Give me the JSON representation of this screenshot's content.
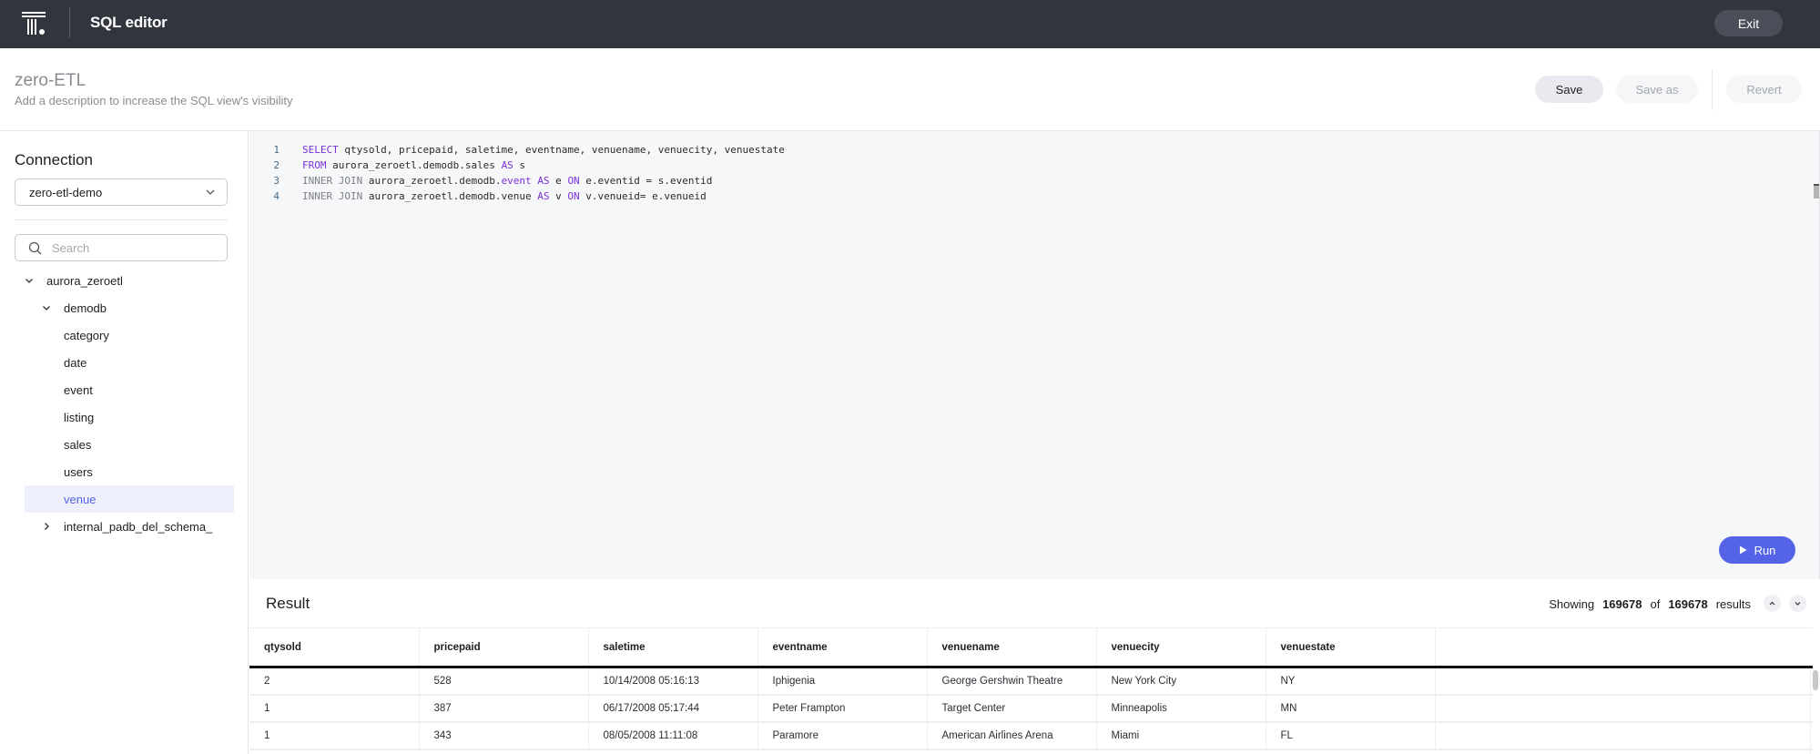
{
  "topbar": {
    "logo": "thoughtspot-logo",
    "title": "SQL editor",
    "exit_label": "Exit"
  },
  "header": {
    "title": "zero-ETL",
    "description": "Add a description to increase the SQL view's visibility",
    "save_label": "Save",
    "save_as_label": "Save as",
    "revert_label": "Revert"
  },
  "sidebar": {
    "connection_label": "Connection",
    "connection_value": "zero-etl-demo",
    "search_placeholder": "Search",
    "tree": [
      {
        "label": "aurora_zeroetl",
        "level": 0,
        "expanded": true
      },
      {
        "label": "demodb",
        "level": 1,
        "expanded": true
      },
      {
        "label": "category",
        "level": 2
      },
      {
        "label": "date",
        "level": 2
      },
      {
        "label": "event",
        "level": 2
      },
      {
        "label": "listing",
        "level": 2
      },
      {
        "label": "sales",
        "level": 2
      },
      {
        "label": "users",
        "level": 2
      },
      {
        "label": "venue",
        "level": 2,
        "selected": true
      },
      {
        "label": "internal_padb_del_schema_",
        "level": 1,
        "expanded": false
      }
    ]
  },
  "editor": {
    "lines": [
      {
        "num": "1",
        "tokens": [
          {
            "t": "SELECT",
            "c": "kw"
          },
          {
            "t": " qtysold, pricepaid, saletime, eventname, venuename, venuecity, venuestate",
            "c": ""
          }
        ]
      },
      {
        "num": "2",
        "tokens": [
          {
            "t": "FROM",
            "c": "kw"
          },
          {
            "t": " aurora_zeroetl.demodb.sales ",
            "c": ""
          },
          {
            "t": "AS",
            "c": "kw"
          },
          {
            "t": " s",
            "c": ""
          }
        ]
      },
      {
        "num": "3",
        "tokens": [
          {
            "t": "INNER JOIN",
            "c": "kw2"
          },
          {
            "t": " aurora_zeroetl.demodb.",
            "c": ""
          },
          {
            "t": "event",
            "c": "kw"
          },
          {
            "t": " ",
            "c": ""
          },
          {
            "t": "AS",
            "c": "kw"
          },
          {
            "t": " e ",
            "c": ""
          },
          {
            "t": "ON",
            "c": "kw"
          },
          {
            "t": " e.eventid = s.eventid",
            "c": ""
          }
        ]
      },
      {
        "num": "4",
        "tokens": [
          {
            "t": "INNER JOIN",
            "c": "kw2"
          },
          {
            "t": " aurora_zeroetl.demodb.venue ",
            "c": ""
          },
          {
            "t": "AS",
            "c": "kw"
          },
          {
            "t": " v ",
            "c": ""
          },
          {
            "t": "ON",
            "c": "kw"
          },
          {
            "t": " v.venueid= e.venueid",
            "c": ""
          }
        ]
      }
    ],
    "run_label": "Run"
  },
  "result": {
    "title": "Result",
    "showing_label": "Showing",
    "shown_count": "169678",
    "of_label": "of",
    "total_count": "169678",
    "results_label": "results",
    "columns": [
      "qtysold",
      "pricepaid",
      "saletime",
      "eventname",
      "venuename",
      "venuecity",
      "venuestate"
    ],
    "rows": [
      [
        "2",
        "528",
        "10/14/2008 05:16:13",
        "Iphigenia",
        "George Gershwin Theatre",
        "New York City",
        "NY"
      ],
      [
        "1",
        "387",
        "06/17/2008 05:17:44",
        "Peter Frampton",
        "Target Center",
        "Minneapolis",
        "MN"
      ],
      [
        "1",
        "343",
        "08/05/2008 11:11:08",
        "Paramore",
        "American Airlines Arena",
        "Miami",
        "FL"
      ]
    ]
  },
  "colors": {
    "accent": "#5563e6",
    "topbar_bg": "#32343e",
    "selected_bg": "#eef0fb",
    "keyword": "#7a2fd9"
  }
}
